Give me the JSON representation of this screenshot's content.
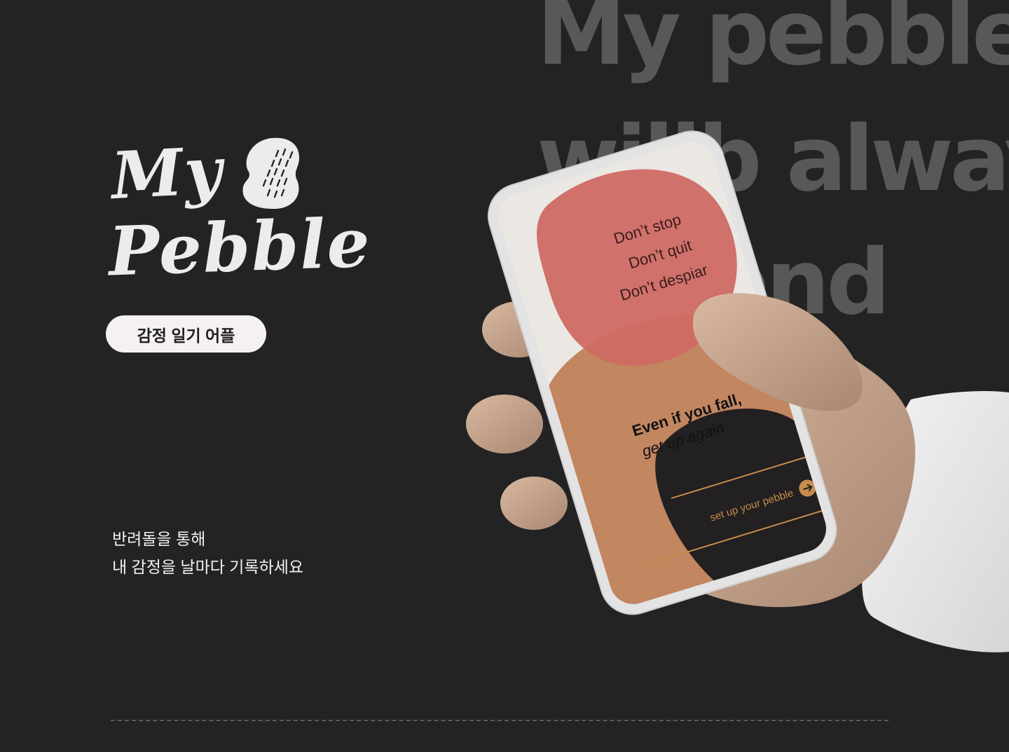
{
  "background": {
    "color": "#232323",
    "text_lines": [
      "My pebble",
      "willb alway",
      "r friend"
    ],
    "text_color": "#585858"
  },
  "logo": {
    "line1": "My",
    "line2": "Pebble",
    "icon": "pebble-stone-icon"
  },
  "tag": {
    "label": "감정 일기 어플"
  },
  "description": {
    "line1": "반려돌을 통해",
    "line2": "내 감정을 날마다 기록하세요"
  },
  "phone": {
    "quote_lines": [
      "Don’t stop",
      "Don’t quit",
      "Don’t despiar"
    ],
    "headline": "Even if you fall,",
    "subline": "get up again",
    "cta_label": "set up your pebble",
    "cta_icon": "arrow-right-icon",
    "colors": {
      "red": "#cf6a64",
      "tan": "#c28660",
      "dark": "#222020",
      "accent": "#c98c4c"
    }
  }
}
